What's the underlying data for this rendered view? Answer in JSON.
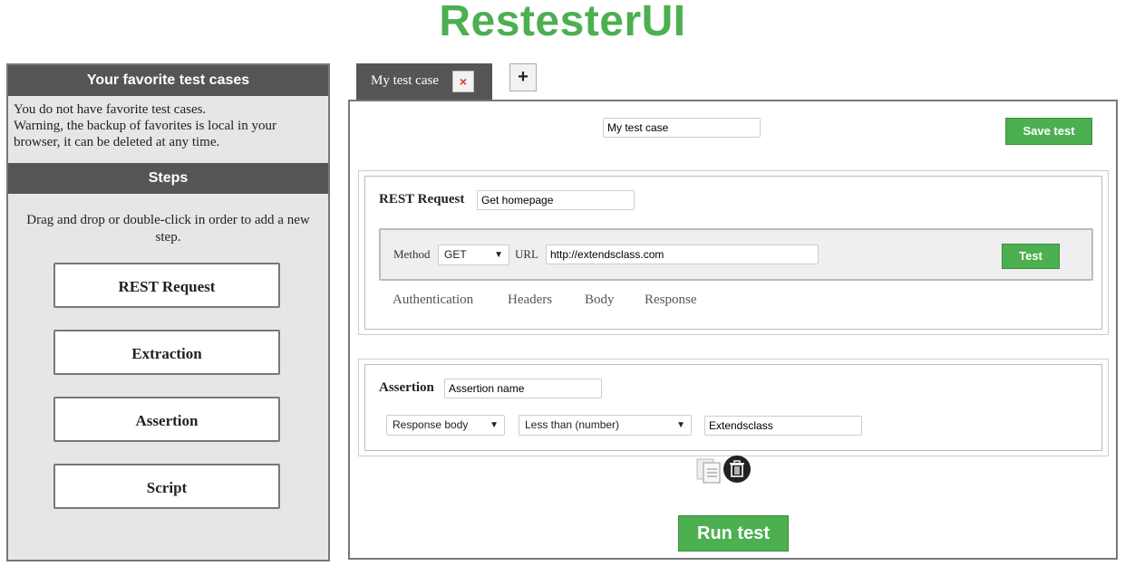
{
  "app": {
    "title": "RestesterUI"
  },
  "left_panel": {
    "favorites": {
      "header": "Your favorite test cases",
      "empty_text": "You do not have favorite test cases.",
      "warning": "Warning, the backup of favorites is local in your browser, it can be deleted at any time."
    },
    "steps": {
      "header": "Steps",
      "hint": "Drag and drop or double-click in order to add a new step.",
      "items": [
        {
          "label": "REST Request"
        },
        {
          "label": "Extraction"
        },
        {
          "label": "Assertion"
        },
        {
          "label": "Script"
        }
      ]
    }
  },
  "tabs": [
    {
      "label": "My test case",
      "close_icon": "×"
    }
  ],
  "add_tab": {
    "label": "+"
  },
  "test_case": {
    "name_value": "My test case",
    "save_label": "Save test"
  },
  "rest_request": {
    "label": "REST Request",
    "name_value": "Get homepage",
    "method_label": "Method",
    "method_value": "GET",
    "url_label": "URL",
    "url_value": "http://extendsclass.com",
    "test_label": "Test",
    "subtabs": [
      "Authentication",
      "Headers",
      "Body",
      "Response"
    ]
  },
  "assertion": {
    "label": "Assertion",
    "name_value": "Assertion name",
    "source_value": "Response body",
    "operator_value": "Less than (number)",
    "expected_value": "Extendsclass"
  },
  "actions": {
    "copy_icon": "copy-icon",
    "delete_icon": "trash-icon",
    "run_label": "Run test"
  },
  "colors": {
    "accent": "#4caf50",
    "header_bg": "#555555",
    "panel_bg": "#e6e6e6"
  }
}
